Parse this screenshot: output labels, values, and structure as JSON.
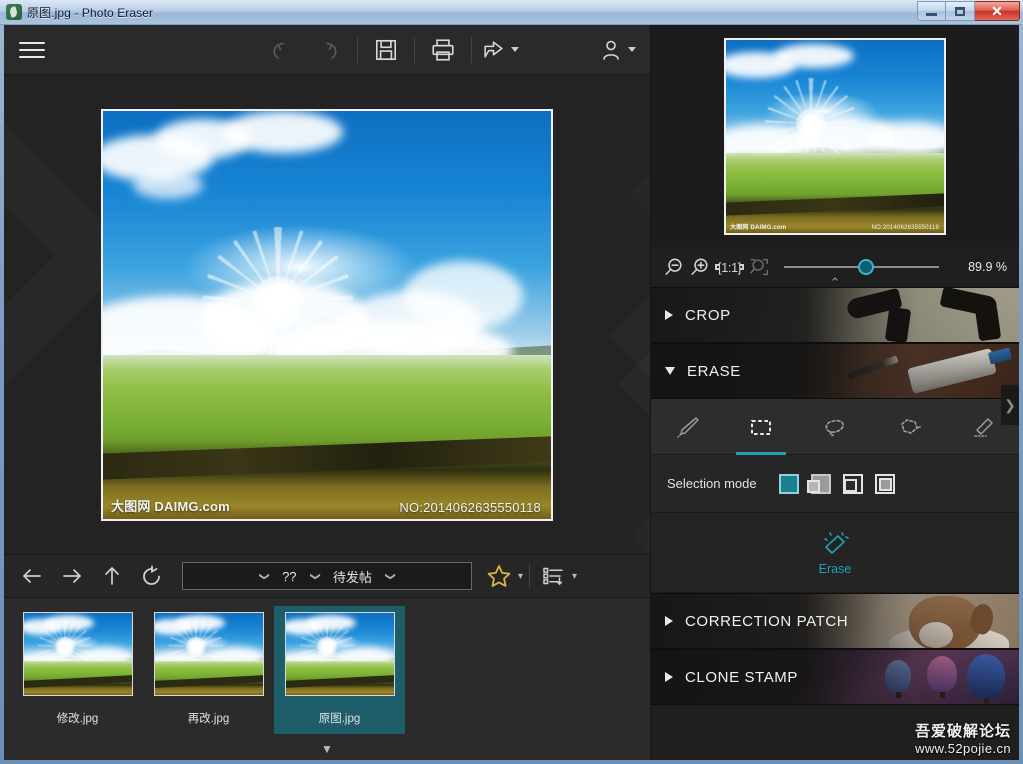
{
  "window": {
    "title": "原图.jpg - Photo Eraser",
    "icon": "app-logo-icon",
    "buttons": {
      "minimize": "—",
      "maximize": "▣",
      "close": "✕"
    }
  },
  "toolbar": {
    "menu": "menu-hamburger",
    "undo": "undo-icon",
    "redo": "redo-icon",
    "save": "save-icon",
    "print": "print-icon",
    "share": "share-icon",
    "account": "account-icon"
  },
  "canvas": {
    "photo": {
      "watermark_left": "大图网 DAIMG.com",
      "watermark_right": "NO:2014062635550118"
    }
  },
  "navbar": {
    "back": "←",
    "forward": "→",
    "up": "↑",
    "refresh": "↻",
    "breadcrumb": {
      "root_chevron": "❯",
      "segment1": "??",
      "sep_chevron": "❯",
      "segment2": "待发帖",
      "end_chevron": "❯"
    },
    "favorites": "star-icon",
    "favorites_caret": "▾",
    "sort": "sort-list-icon",
    "sort_caret": "▾"
  },
  "filmstrip": {
    "items": [
      {
        "label": "修改.jpg",
        "selected": false
      },
      {
        "label": "再改.jpg",
        "selected": false
      },
      {
        "label": "原图.jpg",
        "selected": true
      }
    ],
    "expand": "▼"
  },
  "preview": {
    "watermark_left": "大图网 DAIMG.com",
    "watermark_right": "NO:2014062635550118"
  },
  "zoom": {
    "zoom_out": "zoom-out-icon",
    "zoom_in": "zoom-in-icon",
    "actual_size": "[1:1]",
    "fit_screen": "fit-screen-icon",
    "percent": "89.9 %",
    "collapse": "⌃"
  },
  "sections": [
    {
      "id": "crop",
      "label": "CROP",
      "expanded": false,
      "triangle": "▶"
    },
    {
      "id": "erase",
      "label": "ERASE",
      "expanded": true,
      "triangle": "◢"
    },
    {
      "id": "patch",
      "label": "CORRECTION PATCH",
      "expanded": false,
      "triangle": "▶"
    },
    {
      "id": "clone",
      "label": "CLONE STAMP",
      "expanded": false,
      "triangle": "▶"
    }
  ],
  "erase_panel": {
    "tools": [
      {
        "name": "brush-tool",
        "active": false
      },
      {
        "name": "rectangle-select-tool",
        "active": true
      },
      {
        "name": "lasso-tool",
        "active": false
      },
      {
        "name": "polygon-lasso-tool",
        "active": false
      },
      {
        "name": "eraser-tool",
        "active": false
      }
    ],
    "selection_mode_label": "Selection mode",
    "selection_modes": [
      {
        "name": "new-selection",
        "active": true
      },
      {
        "name": "add-to-selection",
        "active": false
      },
      {
        "name": "subtract-selection",
        "active": false
      },
      {
        "name": "intersect-selection",
        "active": false
      }
    ],
    "action_label": "Erase"
  },
  "panel_collapse": "❯",
  "forum_watermark": {
    "line1": "吾爱破解论坛",
    "line2": "www.52pojie.cn"
  },
  "colors": {
    "accent_teal": "#1fa0b5",
    "selected_thumb": "#1d5e6a",
    "panel_bg": "#1f1f1f",
    "toolbar_bg": "#2a2a2a",
    "title_close": "#c53327"
  }
}
